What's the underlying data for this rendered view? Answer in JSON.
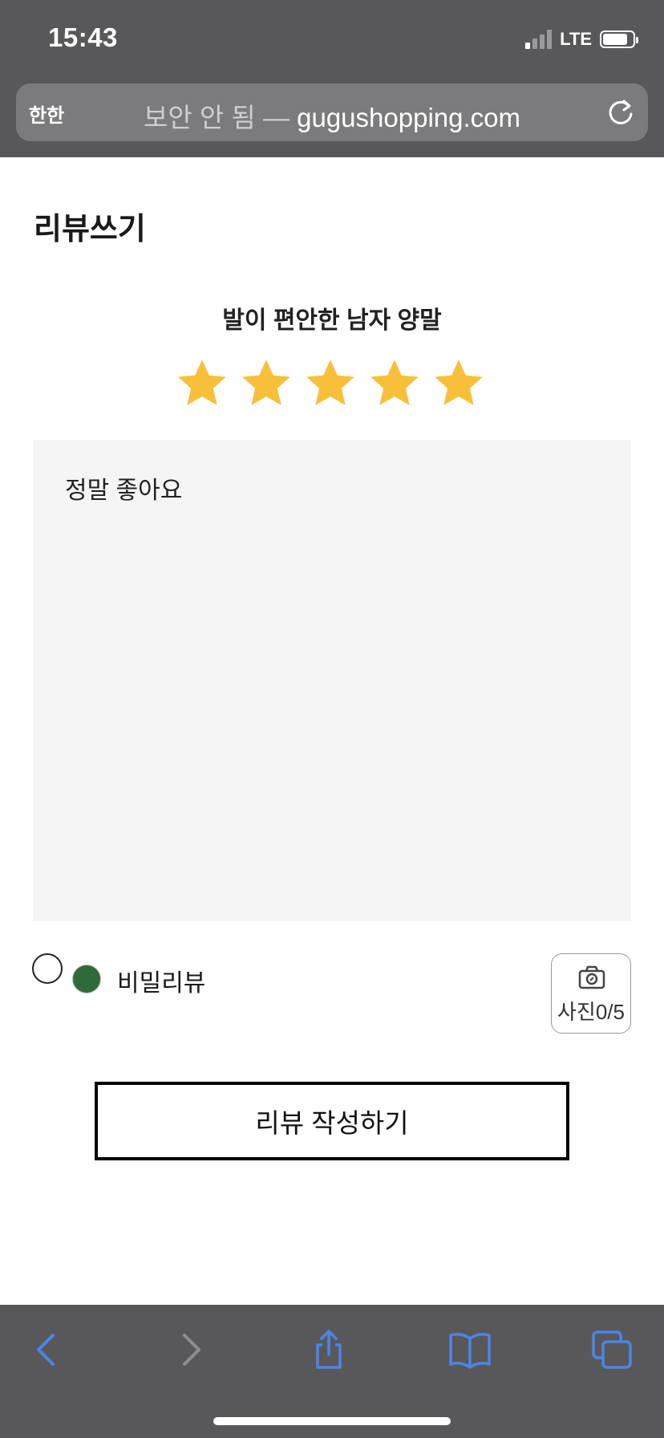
{
  "status_bar": {
    "time": "15:43",
    "network": "LTE"
  },
  "browser": {
    "aa_label": "한한",
    "url_insecure_label": "보안 안 됨 —",
    "url_domain": "gugushopping.com"
  },
  "page": {
    "heading": "리뷰쓰기",
    "product_name": "발이 편안한 남자 양말",
    "rating": {
      "value": 5,
      "max": 5
    },
    "review_text": "정말 좋아요",
    "secret_review_label": "비밀리뷰",
    "photo_label": "사진0/5",
    "submit_label": "리뷰 작성하기"
  },
  "colors": {
    "star": "#F8BF3A",
    "radio_selected": "#2F6B3A",
    "toolbar_icon": "#4A86E8",
    "chrome_bg": "#58585A"
  },
  "toolbar": {
    "icons": [
      "back-icon",
      "forward-icon",
      "share-icon",
      "bookmarks-icon",
      "tabs-icon"
    ]
  }
}
